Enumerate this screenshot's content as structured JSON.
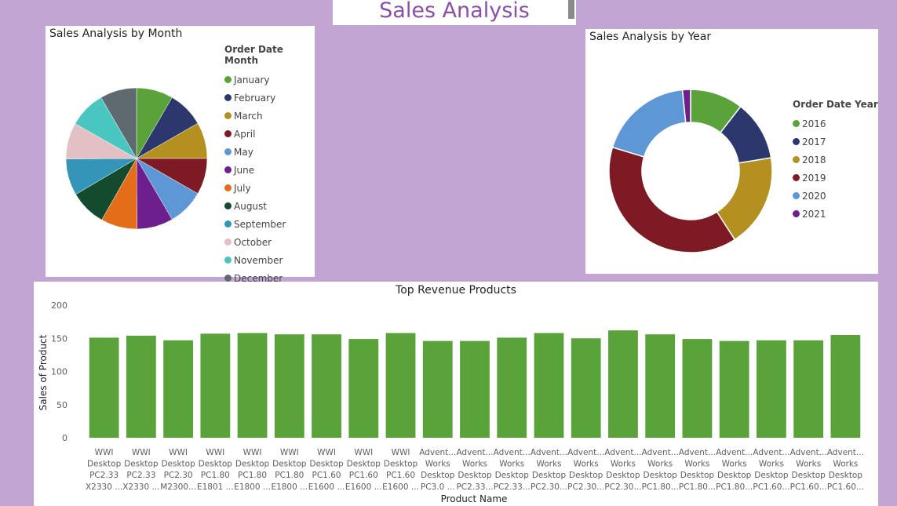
{
  "page": {
    "title": "Sales Analysis"
  },
  "month_chart": {
    "title": "Sales Analysis by Month",
    "legend_title": "Order Date Month",
    "chart_data": {
      "type": "pie",
      "title": "Sales Analysis by Month",
      "categories": [
        "January",
        "February",
        "March",
        "April",
        "May",
        "June",
        "July",
        "August",
        "September",
        "October",
        "November",
        "December"
      ],
      "values": [
        8.4,
        8.3,
        8.3,
        8.3,
        8.3,
        8.3,
        8.3,
        8.3,
        8.4,
        8.3,
        8.4,
        8.4
      ],
      "colors": [
        "#5aa33a",
        "#2c376e",
        "#b3901f",
        "#7e1a24",
        "#5e97d6",
        "#6e1f8e",
        "#e46d1a",
        "#144b2e",
        "#3595b9",
        "#e2c0c4",
        "#4ac6c1",
        "#5e6a6f"
      ],
      "legend": "right"
    }
  },
  "year_chart": {
    "title": "Sales Analysis by Year",
    "legend_title": "Order Date Year",
    "chart_data": {
      "type": "pie",
      "style": "donut",
      "title": "Sales Analysis by Year",
      "categories": [
        "2016",
        "2017",
        "2018",
        "2019",
        "2020",
        "2021"
      ],
      "values": [
        10.5,
        11.9,
        18.5,
        38.8,
        18.7,
        1.6
      ],
      "colors": [
        "#5aa33a",
        "#2c376e",
        "#b3901f",
        "#7e1a24",
        "#5e97d6",
        "#6e1f8e"
      ],
      "legend": "right"
    }
  },
  "bar_chart": {
    "title": "Top Revenue Products",
    "chart_data": {
      "type": "bar",
      "title": "Top Revenue Products",
      "xlabel": "Product Name",
      "ylabel": "Sales of Product",
      "ylim": [
        0,
        200
      ],
      "yticks": [
        0,
        50,
        100,
        150,
        200
      ],
      "grid": false,
      "color": "#5aa33a",
      "categories": [
        [
          "WWI",
          "Desktop",
          "PC2.33",
          "X2330 ..."
        ],
        [
          "WWI",
          "Desktop",
          "PC2.33",
          "X2330 ..."
        ],
        [
          "WWI",
          "Desktop",
          "PC2.30",
          "M2300..."
        ],
        [
          "WWI",
          "Desktop",
          "PC1.80",
          "E1801 ..."
        ],
        [
          "WWI",
          "Desktop",
          "PC1.80",
          "E1800 ..."
        ],
        [
          "WWI",
          "Desktop",
          "PC1.80",
          "E1800 ..."
        ],
        [
          "WWI",
          "Desktop",
          "PC1.60",
          "E1600 ..."
        ],
        [
          "WWI",
          "Desktop",
          "PC1.60",
          "E1600 ..."
        ],
        [
          "WWI",
          "Desktop",
          "PC1.60",
          "E1600 ..."
        ],
        [
          "Advent...",
          "Works",
          "Desktop",
          "PC3.0 ..."
        ],
        [
          "Advent...",
          "Works",
          "Desktop",
          "PC2.33..."
        ],
        [
          "Advent...",
          "Works",
          "Desktop",
          "PC2.33..."
        ],
        [
          "Advent...",
          "Works",
          "Desktop",
          "PC2.30..."
        ],
        [
          "Advent...",
          "Works",
          "Desktop",
          "PC2.30..."
        ],
        [
          "Advent...",
          "Works",
          "Desktop",
          "PC2.30..."
        ],
        [
          "Advent...",
          "Works",
          "Desktop",
          "PC1.80..."
        ],
        [
          "Advent...",
          "Works",
          "Desktop",
          "PC1.80..."
        ],
        [
          "Advent...",
          "Works",
          "Desktop",
          "PC1.80..."
        ],
        [
          "Advent...",
          "Works",
          "Desktop",
          "PC1.60..."
        ],
        [
          "Advent...",
          "Works",
          "Desktop",
          "PC1.60..."
        ],
        [
          "Advent...",
          "Works",
          "Desktop",
          "PC1.60..."
        ]
      ],
      "values": [
        151,
        154,
        147,
        157,
        158,
        156,
        156,
        149,
        158,
        146,
        146,
        151,
        158,
        150,
        162,
        156,
        149,
        146,
        147,
        147,
        155
      ]
    }
  }
}
